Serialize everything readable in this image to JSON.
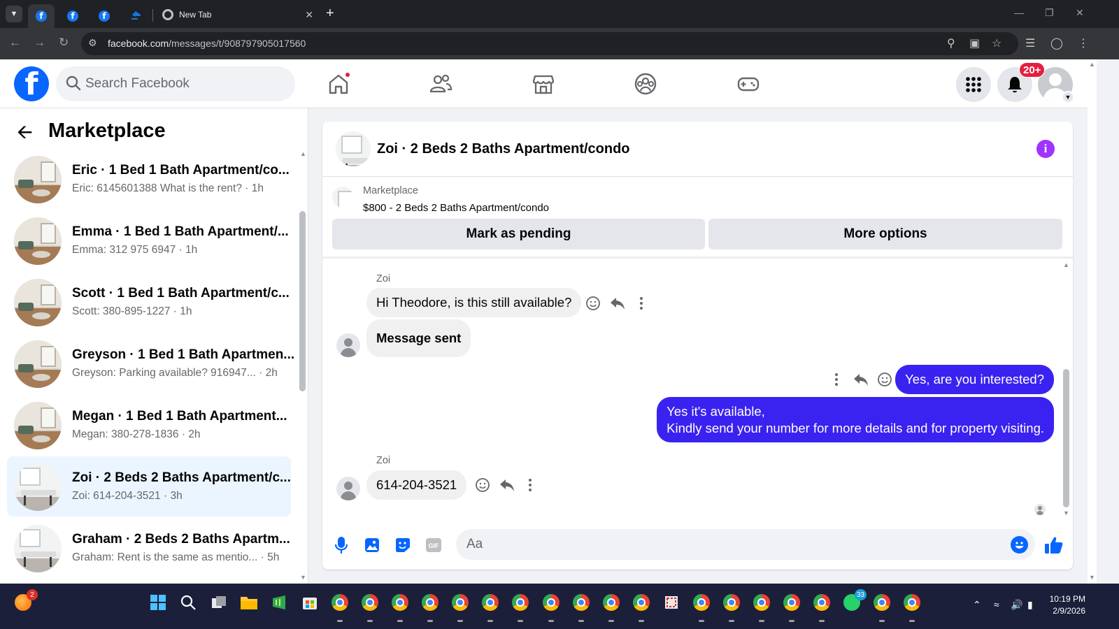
{
  "browser": {
    "tabs": [
      {
        "icon": "facebook-favicon",
        "active": true
      },
      {
        "icon": "facebook-favicon",
        "active": false
      },
      {
        "icon": "facebook-favicon",
        "active": false
      },
      {
        "icon": "zillow-favicon",
        "active": false
      },
      {
        "icon": "chrome-favicon",
        "label": "New Tab"
      }
    ],
    "url_host": "facebook.com",
    "url_path": "/messages/t/908797905017560"
  },
  "fb_header": {
    "search_placeholder": "Search Facebook",
    "notifications_badge": "20+",
    "nav": [
      "home-icon",
      "friends-icon",
      "marketplace-icon",
      "groups-icon",
      "gaming-icon"
    ]
  },
  "sidebar": {
    "title": "Marketplace",
    "conversations": [
      {
        "name": "Eric · 1 Bed 1 Bath Apartment/co...",
        "preview": "Eric: 6145601388 What is the rent? · 1h",
        "thumb": "living-room"
      },
      {
        "name": "Emma · 1 Bed 1 Bath Apartment/...",
        "preview": "Emma: 312 975 6947 · 1h",
        "thumb": "living-room"
      },
      {
        "name": "Scott · 1 Bed 1 Bath Apartment/c...",
        "preview": "Scott: 380-895-1227 · 1h",
        "thumb": "living-room"
      },
      {
        "name": "Greyson · 1 Bed 1 Bath Apartmen...",
        "preview": "Greyson: Parking available? 916947...  · 2h",
        "thumb": "living-room"
      },
      {
        "name": "Megan · 1 Bed 1 Bath Apartment...",
        "preview": "Megan: 380-278-1836 · 2h",
        "thumb": "living-room"
      },
      {
        "name": "Zoi · 2 Beds 2 Baths Apartment/c...",
        "preview": "Zoi: 614-204-3521 · 3h",
        "thumb": "kitchen",
        "active": true
      },
      {
        "name": "Graham · 2 Beds 2 Baths Apartm...",
        "preview": "Graham: Rent is the same as mentio... · 5h",
        "thumb": "kitchen"
      }
    ]
  },
  "chat": {
    "title": "Zoi · 2 Beds 2 Baths Apartment/condo",
    "listing": {
      "label": "Marketplace",
      "item": "$800 - 2 Beds 2 Baths Apartment/condo",
      "mark_pending": "Mark as pending",
      "more_options": "More options"
    },
    "messages": {
      "sender1": "Zoi",
      "m1": "Hi Theodore, is this still available?",
      "m2": "Message sent",
      "m3": "Yes, are you interested?",
      "m4_line1": "Yes it's available,",
      "m4_line2": "Kindly send your number for more details and for property visiting.",
      "sender2": "Zoi",
      "m5": "614-204-3521"
    },
    "composer_placeholder": "Aa"
  },
  "taskbar": {
    "firefox_badge": "2",
    "whatsapp_badge": "33",
    "time": "10:19 PM",
    "date": "2/9/2026"
  },
  "colors": {
    "fb_blue": "#0866ff",
    "outgoing_bubble": "#3a22f0",
    "info_purple": "#a033ff",
    "active_convo": "#ebf5ff"
  }
}
